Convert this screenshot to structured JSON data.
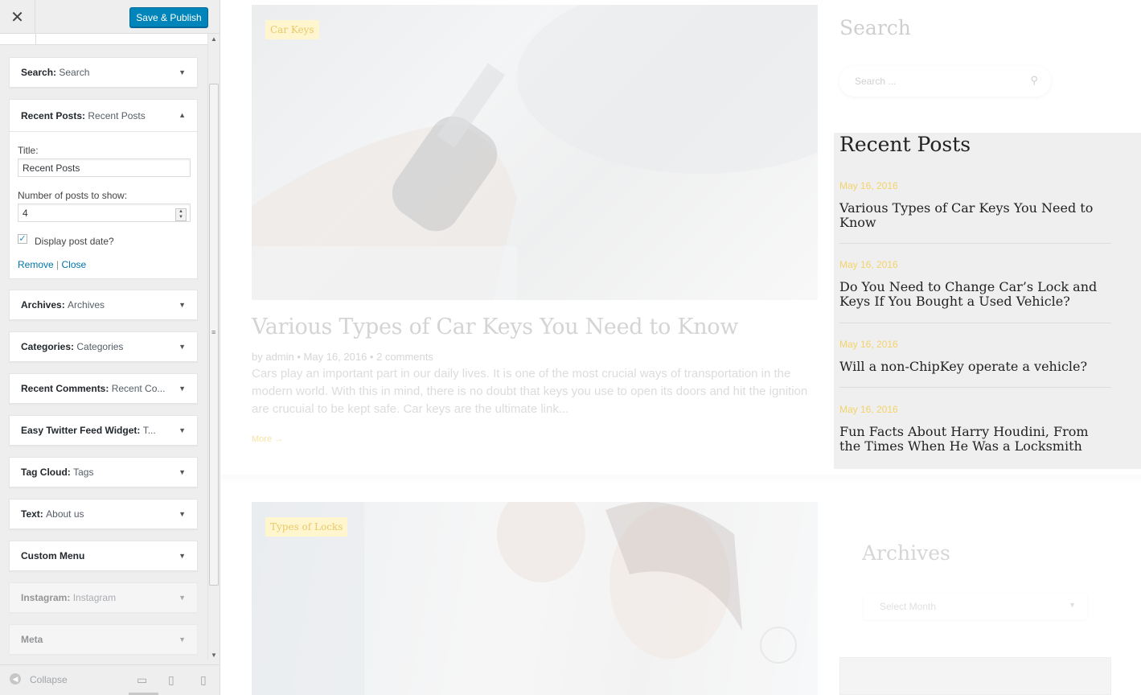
{
  "sidebar": {
    "close_icon": "close-icon",
    "save_label": "Save & Publish",
    "widgets_top": [
      {
        "title": "Search",
        "subtitle": "Search"
      }
    ],
    "recent_posts_widget": {
      "title": "Recent Posts",
      "subtitle": "Recent Posts",
      "title_label": "Title:",
      "title_value": "Recent Posts",
      "count_label": "Number of posts to show:",
      "count_value": "4",
      "date_label": "Display post date?",
      "date_checked": true,
      "remove_label": "Remove",
      "separator": "|",
      "close_label": "Close"
    },
    "widgets": [
      {
        "title": "Archives",
        "subtitle": "Archives"
      },
      {
        "title": "Categories",
        "subtitle": "Categories"
      },
      {
        "title": "Recent Comments",
        "subtitle": "Recent Co..."
      },
      {
        "title": "Easy Twitter Feed Widget",
        "subtitle": "T..."
      },
      {
        "title": "Tag Cloud",
        "subtitle": "Tags"
      },
      {
        "title": "Text",
        "subtitle": "About us"
      },
      {
        "title": "Custom Menu",
        "subtitle": ""
      },
      {
        "title": "Instagram",
        "subtitle": "Instagram"
      },
      {
        "title": "Meta",
        "subtitle": ""
      }
    ],
    "footer": {
      "collapse_label": "Collapse",
      "devices": [
        "desktop-icon",
        "tablet-icon",
        "mobile-icon"
      ]
    }
  },
  "preview": {
    "post1": {
      "category": "Car Keys",
      "title": "Various Types of Car Keys You Need to Know",
      "meta": "by admin  •  May 16, 2016  •  2 comments",
      "excerpt": "Cars play an important part in our daily lives. It is one of the most crucial ways of transportation in the modern world. With this in mind, there is no doubt that keys you use to open its doors and hit the ignition are crucuial to be kept safe. Car keys are the ultimate link...",
      "read_more": "More  →"
    },
    "post2": {
      "category": "Types of Locks"
    },
    "search_widget": {
      "title": "Search",
      "placeholder": "Search ..."
    },
    "recent_posts": {
      "title": "Recent Posts",
      "items": [
        {
          "date": "May 16, 2016",
          "title": "Various Types of Car Keys You Need to Know"
        },
        {
          "date": "May 16, 2016",
          "title": "Do You Need to Change Car’s Lock and Keys If You Bought a Used Vehicle?"
        },
        {
          "date": "May 16, 2016",
          "title": "Will a non-ChipKey operate a vehicle?"
        },
        {
          "date": "May 16, 2016",
          "title": "Fun Facts About Harry Houdini, From the Times When He Was a Locksmith"
        }
      ]
    },
    "archives_widget": {
      "title": "Archives",
      "select_value": "Select Month"
    }
  },
  "colors": {
    "accent": "#0085ba",
    "link": "#0073aa",
    "date_yellow": "#f3d36a"
  }
}
